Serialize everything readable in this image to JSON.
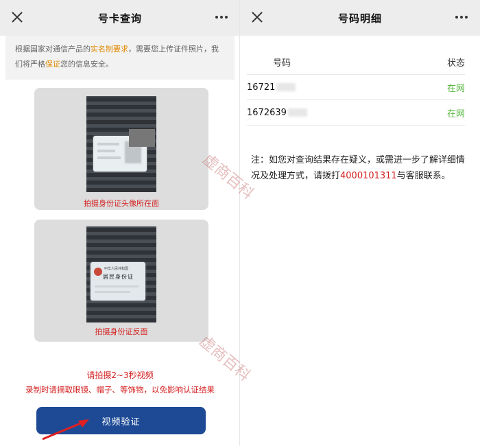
{
  "left": {
    "title": "号卡查询",
    "notice": {
      "part1": "根据国家对通信产品的",
      "highlight1": "实名制要求",
      "part2": "，需要您上传证件照片，我们将严格",
      "highlight2": "保证",
      "part3": "您的信息安全。"
    },
    "card_front": {
      "caption": "拍摄身份证头像所在面"
    },
    "card_back": {
      "caption": "拍摄身份证反面",
      "card_line1": "中华人民共和国",
      "card_line2": "居民身份证"
    },
    "hint_line1": "请拍摄2~3秒视频",
    "hint_line2": "录制时请摘取眼镜、帽子、等饰物，以免影响认证结果",
    "verify_button": "视频验证"
  },
  "right": {
    "title": "号码明细",
    "table": {
      "headers": [
        "号码",
        "状态"
      ],
      "rows": [
        {
          "number": "16721",
          "status": "在网"
        },
        {
          "number": "1672639",
          "status": "在网"
        }
      ]
    },
    "note": {
      "part1": "注：如您对查询结果存在疑义，或需进一步了解详细情况及处理方式，请拨打",
      "phone": "4000101311",
      "part2": "与客服联系。"
    }
  },
  "watermark": "虚商百科",
  "colors": {
    "accent_red": "#d42020",
    "highlight_orange": "#e08a00",
    "button_blue": "#1e4a95",
    "status_green": "#55b63a"
  }
}
